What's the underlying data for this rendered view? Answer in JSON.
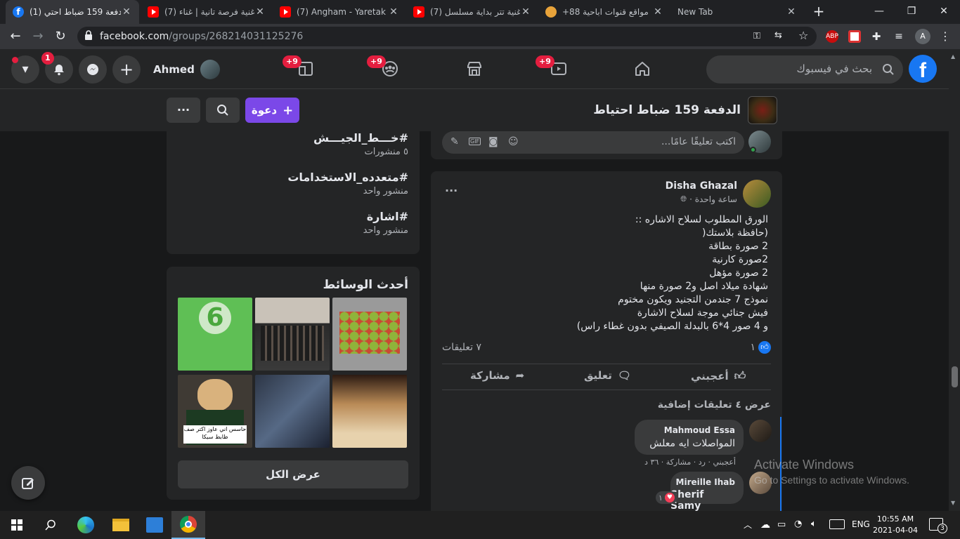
{
  "browser": {
    "tabs": [
      {
        "title": "(1) الدفعة 159 ضباط احتي",
        "icon": "facebook-favicon",
        "active": true
      },
      {
        "title": "(7) أغنية فرصة تانية | غناء",
        "icon": "youtube-favicon"
      },
      {
        "title": "(7) Angham - Yaretak Fa",
        "icon": "youtube-favicon"
      },
      {
        "title": "(7) أغنية تتر بداية مسلسل",
        "icon": "youtube-favicon"
      },
      {
        "title": "+88 مواقع قنوات اباحية",
        "icon": "burger-favicon"
      },
      {
        "title": "New Tab",
        "icon": "none"
      }
    ],
    "url_host": "facebook.com",
    "url_path": "/groups/268214031125276",
    "profile_initial": "A",
    "abp_label": "ABP"
  },
  "fb_header": {
    "user_name": "Ahmed",
    "notifications_badge": "1",
    "gaming_badge": "+9",
    "groups_badge": "+9",
    "watch_badge": "+9",
    "search_placeholder": "بحث في فيسبوك",
    "logo_letter": "f"
  },
  "group": {
    "name": "الدفعة 159 ضباط احتياط",
    "invite_label": "دعوة",
    "more_label": "···"
  },
  "sidebar": {
    "hashtags": [
      {
        "tag": "#خـــط_الجيـــش",
        "count": "٥ منشورات"
      },
      {
        "tag": "#متعدده_الاستخدامات",
        "count": "منشور واحد"
      },
      {
        "tag": "#اشارة",
        "count": "منشور واحد"
      }
    ],
    "media_title": "أحدث الوسائط",
    "media_caption": "حاسس اني عاوز اكتر صف ظابط سيكا",
    "see_all_label": "عرض الكل"
  },
  "top_comment_box": {
    "placeholder": "اكتب تعليقًا عامًا..."
  },
  "post": {
    "author": "Disha Ghazal",
    "time": "ساعة واحدة ·",
    "more": "···",
    "lines": [
      "الورق المطلوب لسلاح الاشاره ::",
      "(حافظة بلاستك(",
      "2 صورة بطاقة",
      "2صورة كارنية",
      "2 صورة مؤهل",
      "شهادة ميلاد اصل و2 صورة منها",
      "نموذج 7 جندمن التجنيد ويكون مختوم",
      "فيش جنائي موجة لسلاح الاشارة",
      "و 4 صور 4*6 بالبدلة الصيفي بدون غطاء راس)"
    ],
    "likes_count": "١",
    "comments_count": "٧ تعليقات",
    "like_label": "أعجبني",
    "comment_label": "تعليق",
    "share_label": "مشاركة",
    "more_comments_label": "عرض ٤ تعليقات إضافية",
    "comments": [
      {
        "author": "Mahmoud Essa",
        "text": "المواصلات ايه معلش",
        "meta": "أعجبني · رد · مشاركة · ٣٦ د"
      },
      {
        "author": "Mireille Ihab",
        "text": "Sherif Samy",
        "reactions": "١"
      }
    ]
  },
  "watermark": {
    "title": "Activate Windows",
    "subtitle": "Go to Settings to activate Windows."
  },
  "taskbar": {
    "language": "ENG",
    "time": "10:55 AM",
    "date": "2021-04-04",
    "notification_count": "3"
  }
}
